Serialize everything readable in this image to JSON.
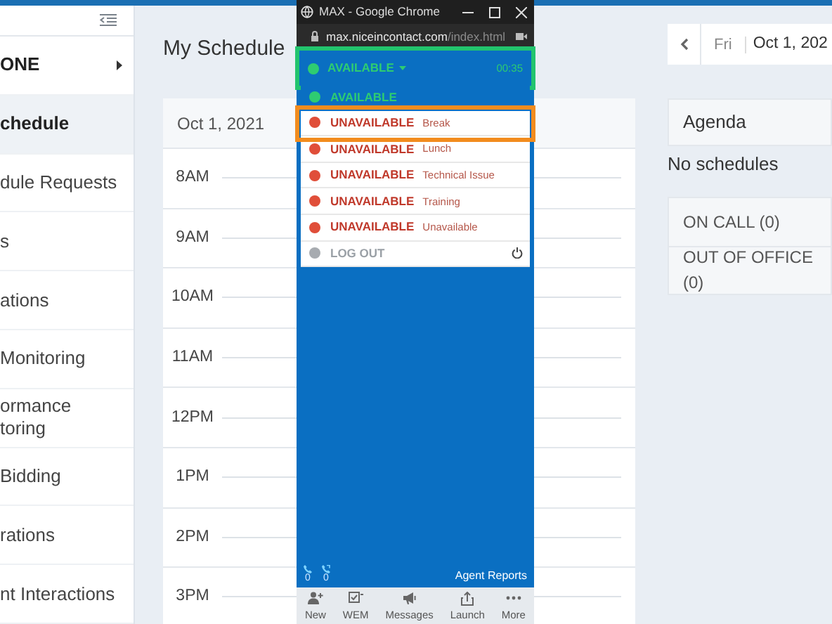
{
  "sidebar": {
    "items": [
      {
        "lines": [
          "ONE"
        ],
        "kind": "profile",
        "selected": false
      },
      {
        "lines": [
          "chedule"
        ],
        "kind": "link",
        "selected": true
      },
      {
        "lines": [
          "dule Requests"
        ],
        "kind": "link",
        "selected": false
      },
      {
        "lines": [
          "s"
        ],
        "kind": "link",
        "selected": false
      },
      {
        "lines": [
          "ations"
        ],
        "kind": "link",
        "selected": false
      },
      {
        "lines": [
          "Monitoring"
        ],
        "kind": "link",
        "selected": false
      },
      {
        "lines": [
          "ormance",
          "toring"
        ],
        "kind": "link",
        "selected": false
      },
      {
        "lines": [
          "Bidding"
        ],
        "kind": "link",
        "selected": false
      },
      {
        "lines": [
          "rations"
        ],
        "kind": "link",
        "selected": false
      },
      {
        "lines": [
          "nt Interactions"
        ],
        "kind": "link",
        "selected": false
      }
    ]
  },
  "page": {
    "title": "My Schedule"
  },
  "schedule": {
    "date": "Oct 1, 2021",
    "hours": [
      "8AM",
      "9AM",
      "10AM",
      "11AM",
      "12PM",
      "1PM",
      "2PM",
      "3PM"
    ]
  },
  "date_nav": {
    "day": "Fri",
    "date": "Oct 1, 202"
  },
  "agenda": {
    "title": "Agenda",
    "empty_text": "No schedules",
    "sections": [
      "ON CALL (0)",
      "OUT OF OFFICE (0)"
    ]
  },
  "popup": {
    "window_title": "MAX - Google Chrome",
    "url_domain": "max.niceincontact.com",
    "url_path": "/index.html",
    "status": {
      "label": "AVAILABLE",
      "timer": "00:35",
      "color": "#2ecc71",
      "highlighted": true
    },
    "states": [
      {
        "kind": "available",
        "label": "AVAILABLE",
        "selected": true,
        "color": "#2ecc71",
        "highlighted": false
      },
      {
        "kind": "unavailable",
        "label": "UNAVAILABLE",
        "reason": "Break",
        "selected": false,
        "color": "#e04e39",
        "highlighted": true
      },
      {
        "kind": "unavailable",
        "label": "UNAVAILABLE",
        "reason": "Lunch",
        "selected": false,
        "color": "#e04e39",
        "highlighted": false
      },
      {
        "kind": "unavailable",
        "label": "UNAVAILABLE",
        "reason": "Technical Issue",
        "selected": false,
        "color": "#e04e39",
        "highlighted": false
      },
      {
        "kind": "unavailable",
        "label": "UNAVAILABLE",
        "reason": "Training",
        "selected": false,
        "color": "#e04e39",
        "highlighted": false
      },
      {
        "kind": "unavailable",
        "label": "UNAVAILABLE",
        "reason": "Unavailable",
        "selected": false,
        "color": "#e04e39",
        "highlighted": false
      },
      {
        "kind": "logout",
        "label": "LOG OUT",
        "selected": false,
        "color": "#a7abb0",
        "highlighted": false
      }
    ],
    "counters": [
      "0",
      "0"
    ],
    "reports_link": "Agent Reports",
    "nav": [
      {
        "kind": "new",
        "label": "New"
      },
      {
        "kind": "wem",
        "label": "WEM"
      },
      {
        "kind": "messages",
        "label": "Messages"
      },
      {
        "kind": "launch",
        "label": "Launch"
      },
      {
        "kind": "more",
        "label": "More"
      }
    ]
  }
}
